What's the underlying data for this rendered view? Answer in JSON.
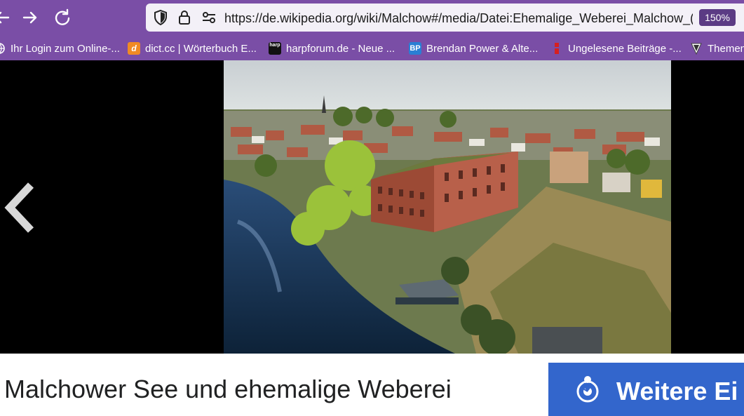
{
  "browser": {
    "url_prefix": "https://de.",
    "url_host": "wikipedia.org",
    "url_path": "/wiki/Malchow#/media/Datei:Ehemalige_Weberei_Malchow_(M",
    "url_fade": "e",
    "zoom": "150%",
    "accent_color": "#7a4ea6"
  },
  "bookmarks": [
    {
      "label": "Ihr Login zum Online-...",
      "icon": "globe-icon"
    },
    {
      "label": "dict.cc | Wörterbuch E...",
      "icon": "dictcc-icon",
      "icon_letter": "d"
    },
    {
      "label": "harpforum.de - Neue ...",
      "icon": "harpforum-icon",
      "icon_letter": "harp"
    },
    {
      "label": "Brendan Power & Alte...",
      "icon": "bp-icon",
      "icon_letter": "BP"
    },
    {
      "label": "Ungelesene Beiträge -...",
      "icon": "red-marker-icon"
    },
    {
      "label": "Themen",
      "icon": "shield-icon"
    }
  ],
  "viewer": {
    "image_alt": "Ehemalige Weberei Malchow",
    "caption": "Malchower See und ehemalige Weberei",
    "more_button": "Weitere Ei",
    "button_color": "#3366cc"
  }
}
